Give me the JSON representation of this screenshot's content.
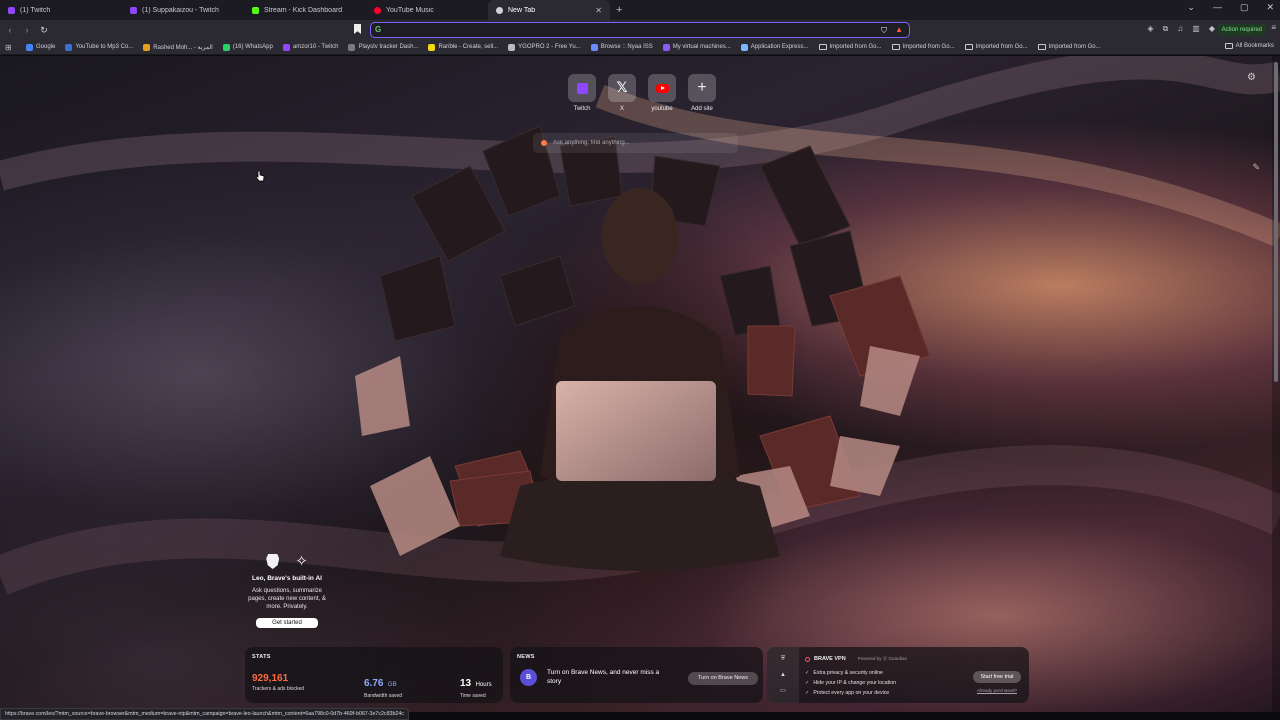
{
  "tabs": [
    {
      "title": "(1) Twitch",
      "color": "#9146ff",
      "active": false
    },
    {
      "title": "(1) Suppakaizou - Twitch",
      "color": "#9146ff",
      "active": false
    },
    {
      "title": "Stream - Kick Dashboard",
      "color": "#53fc18",
      "active": false
    },
    {
      "title": "YouTube Music",
      "color": "#ff0033",
      "active": false
    },
    {
      "title": "New Tab",
      "color": "#cfcfd4",
      "active": true
    }
  ],
  "toolbar": {
    "omnibox_value": "",
    "action_required": "Action required"
  },
  "bookmarks": [
    {
      "label": "Google",
      "color": "#4285f4"
    },
    {
      "label": "YouTube to Mp3 Co...",
      "color": "#3b6fd6"
    },
    {
      "label": "Rashed Moh... - المربة",
      "color": "#e4a11b"
    },
    {
      "label": "(16) WhatsApp",
      "color": "#25d366"
    },
    {
      "label": "amzor10 - Twitch",
      "color": "#9146ff"
    },
    {
      "label": "Playstv tracker Dash...",
      "color": "#7a7a85"
    },
    {
      "label": "Rarible - Create, sell...",
      "color": "#f5d90a"
    },
    {
      "label": "YGOPRO 2 - Free Yu...",
      "color": "#bbbbbb"
    },
    {
      "label": "Browse :: Nyaa ISS",
      "color": "#6b8cff"
    },
    {
      "label": "My virtual machines...",
      "color": "#8a5cf6"
    },
    {
      "label": "Application Express...",
      "color": "#7ab8ff"
    },
    {
      "label": "Imported from Go...",
      "folder": true
    },
    {
      "label": "Imported from Go...",
      "folder": true
    },
    {
      "label": "Imported from Go...",
      "folder": true
    },
    {
      "label": "Imported from Go...",
      "folder": true
    }
  ],
  "all_bookmarks": "All Bookmarks",
  "top_sites": [
    {
      "label": "Twitch",
      "icon": "twitch-icon"
    },
    {
      "label": "X",
      "icon": "x-icon"
    },
    {
      "label": "youtube",
      "icon": "youtube-icon"
    },
    {
      "label": "Add site",
      "icon": "plus-icon"
    }
  ],
  "search": {
    "placeholder": "Ask anything, find anything..."
  },
  "leo": {
    "title": "Leo, Brave's built-in AI",
    "description": "Ask questions, summarize pages, create new content, & more. Privately.",
    "button": "Get started"
  },
  "stats": {
    "title": "STATS",
    "trackers": {
      "value": "929,161",
      "caption": "Trackers & ads blocked",
      "color": "#ff6a3d"
    },
    "bandwidth": {
      "value": "6.76",
      "unit": "GB",
      "caption": "Bandwidth saved",
      "color": "#8fa9ff"
    },
    "time": {
      "value": "13",
      "unit": "Hours",
      "caption": "Time saved",
      "color": "#ffffff"
    }
  },
  "news": {
    "title": "NEWS",
    "badge": "B",
    "text": "Turn on Brave News, and never miss a story",
    "button": "Turn on Brave News"
  },
  "vpn": {
    "title": "BRAVE VPN",
    "powered": "Powered by ⓖ Guardian",
    "features": [
      "Extra privacy & security online",
      "Hide your IP & change your location",
      "Protect every app on your device"
    ],
    "cta": "Start free trial",
    "already": "Already purchased?"
  },
  "status_url": "https://brave.com/leo/?mtm_source=brave-browser&mtm_medium=brave-ntp&mtm_campaign=brave-leo-launch&mtm_content=6aa798c0-0d7b-469f-b067-3e7c2c83b24c"
}
